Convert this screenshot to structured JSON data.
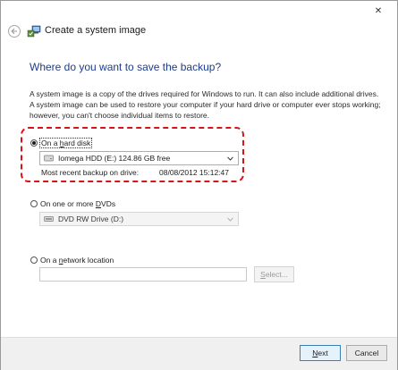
{
  "window": {
    "title": "Create a system image",
    "close_glyph": "✕"
  },
  "page": {
    "title": "Where do you want to save the backup?",
    "description": "A system image is a copy of the drives required for Windows to run. It can also include additional drives. A system image can be used to restore your computer if your hard drive or computer ever stops working; however, you can't choose individual items to restore."
  },
  "hard_disk": {
    "label_pre": "On a ",
    "label_accel": "h",
    "label_post": "ard disk",
    "selected": true,
    "drive_value": "Iomega HDD (E:)  124.86 GB free",
    "recent_label": "Most recent backup on drive:",
    "recent_value": "08/08/2012 15:12:47"
  },
  "dvd": {
    "label_pre": "On one or more ",
    "label_accel": "D",
    "label_post": "VDs",
    "selected": false,
    "drive_value": "DVD RW Drive (D:)"
  },
  "network": {
    "label_pre": "On a ",
    "label_accel": "n",
    "label_post": "etwork location",
    "selected": false,
    "path_value": "",
    "select_button_accel": "S",
    "select_button_rest": "elect..."
  },
  "buttons": {
    "next_accel": "N",
    "next_rest": "ext",
    "cancel": "Cancel"
  },
  "colors": {
    "title_blue": "#1e3d8a",
    "highlight_red": "#d7141a"
  },
  "icons": {
    "close": "close-icon",
    "back": "back-arrow-icon",
    "app": "backup-wizard-icon",
    "hard_drive": "hard-drive-icon",
    "dvd_drive": "dvd-drive-icon",
    "chevron": "chevron-down-icon"
  }
}
